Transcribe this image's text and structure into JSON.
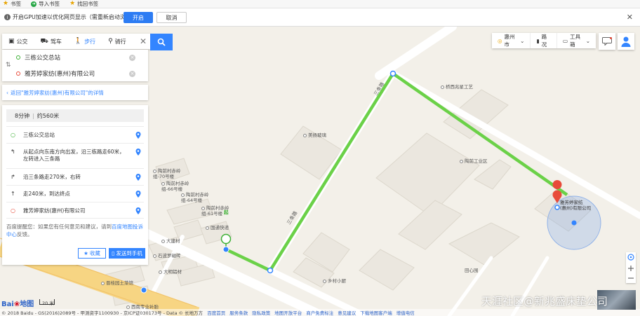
{
  "bookmarks": {
    "items": [
      {
        "label": "书签",
        "icon": "star-icon"
      },
      {
        "label": "导入书签",
        "icon": "import-arrow-icon"
      },
      {
        "label": "找回书签",
        "icon": "star-icon"
      }
    ]
  },
  "infobar": {
    "message": "开启GPU加速以优化网页显示（需重新启动浏览器）",
    "enable_label": "开启",
    "cancel_label": "取消"
  },
  "route_modes": [
    {
      "label": "公交",
      "icon": "bus-icon"
    },
    {
      "label": "驾车",
      "icon": "car-icon"
    },
    {
      "label": "步行",
      "icon": "walk-icon",
      "active": true
    },
    {
      "label": "骑行",
      "icon": "bike-icon"
    }
  ],
  "route": {
    "start": "三栋公交总站",
    "end": "雅芳婷家纺(惠州)有限公司"
  },
  "back_link": "返回\"雅芳婷家纺(惠州)有限公司\"的详情",
  "summary": {
    "time": "8分钟",
    "distance": "约560米"
  },
  "steps": [
    {
      "icon": "start-dot-icon",
      "text": "三栋公交总站"
    },
    {
      "icon": "turn-left-icon",
      "text": "从起点向东南方向出发，沿三栋路走60米，左转进入三条路"
    },
    {
      "icon": "turn-right-icon",
      "text": "沿三条路走270米，右转"
    },
    {
      "icon": "straight-icon",
      "text": "走240米，到达终点"
    },
    {
      "icon": "end-dot-icon",
      "text": "雅芳婷家纺(惠州)有限公司"
    }
  ],
  "tips": {
    "prefix": "百度提醒您：如果您有任何意见和建议，请到",
    "link": "百度地图投诉中心",
    "suffix": "反馈。"
  },
  "actions": {
    "collect": "收藏",
    "send": "发送到手机"
  },
  "toolbar": {
    "city": "惠州市",
    "traffic": "路况",
    "tools": "工具箱"
  },
  "map": {
    "destination_label": "雅芳婷家纺\n(惠州)有限公司",
    "start_badge": "起",
    "end_badge": "终",
    "road_label": "三条路",
    "pois": [
      "桥西兆星工艺",
      "美扬玻璃",
      "陶前工业区",
      "陶前村赤岭组-70号楼",
      "陶前村赤岭组-66号楼",
      "陶前村赤岭组-64号楼",
      "陶前村赤岭组-61号楼",
      "国通快递",
      "大建材",
      "石波罗磁砖",
      "大明铝材",
      "田心围",
      "乡村小厨",
      "晋桂园土菜馆",
      "西南专业补胎"
    ]
  },
  "footer": {
    "copyright": "© 2018 Baidu - GS(2016)2089号 - 甲测资字1100930 - 京ICP证030173号 - Data © 长地万方",
    "links": [
      "百度首页",
      "服务条款",
      "隐私政策",
      "地图开放平台",
      "商户免费标注",
      "意见建议",
      "下载地图客户端",
      "增值电信"
    ],
    "scale": "20 米",
    "logo_text": "Bai",
    "logo_brand": "地图"
  },
  "watermark": "天涯社区@新兆盛床垫公司"
}
